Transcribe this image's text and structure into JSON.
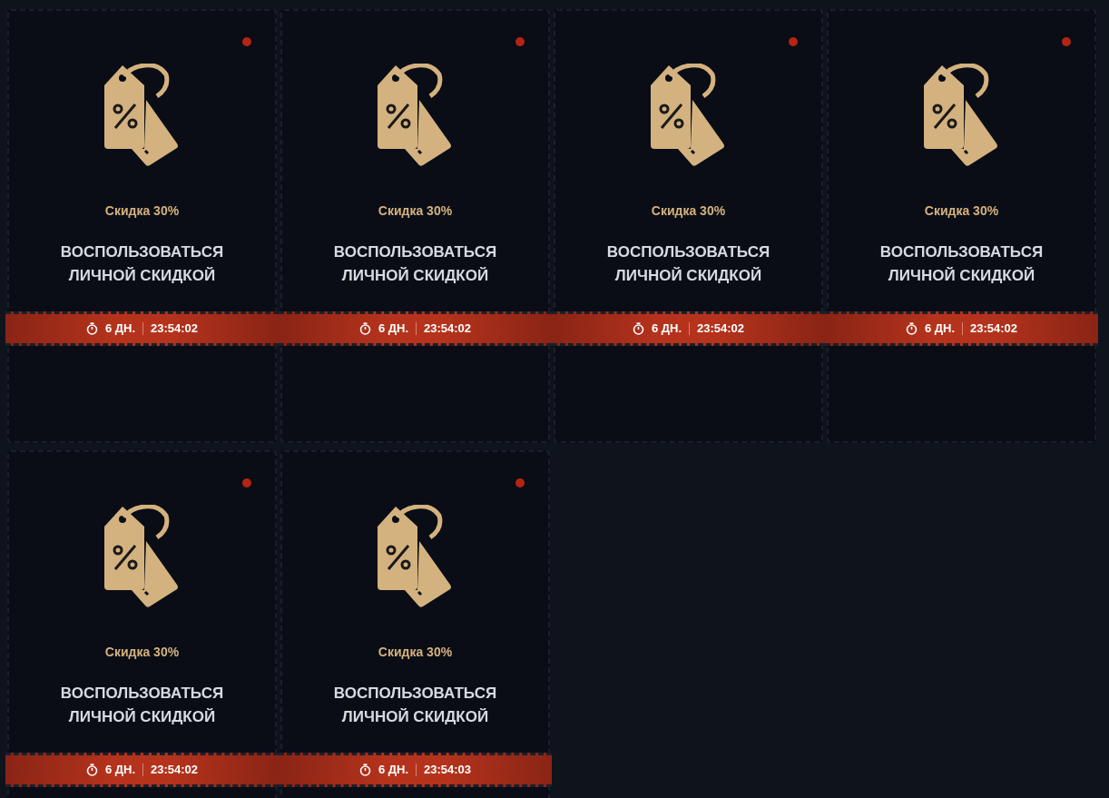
{
  "cards": [
    {
      "discount": "Скидка 30%",
      "title": "ВОСПОЛЬЗОВАТЬСЯ ЛИЧНОЙ СКИДКОЙ",
      "days": "6 ДН.",
      "time": "23:54:02",
      "unread": true
    },
    {
      "discount": "Скидка 30%",
      "title": "ВОСПОЛЬЗОВАТЬСЯ ЛИЧНОЙ СКИДКОЙ",
      "days": "6 ДН.",
      "time": "23:54:02",
      "unread": true
    },
    {
      "discount": "Скидка 30%",
      "title": "ВОСПОЛЬЗОВАТЬСЯ ЛИЧНОЙ СКИДКОЙ",
      "days": "6 ДН.",
      "time": "23:54:02",
      "unread": true
    },
    {
      "discount": "Скидка 30%",
      "title": "ВОСПОЛЬЗОВАТЬСЯ ЛИЧНОЙ СКИДКОЙ",
      "days": "6 ДН.",
      "time": "23:54:02",
      "unread": true
    },
    {
      "discount": "Скидка 30%",
      "title": "ВОСПОЛЬЗОВАТЬСЯ ЛИЧНОЙ СКИДКОЙ",
      "days": "6 ДН.",
      "time": "23:54:02",
      "unread": true
    },
    {
      "discount": "Скидка 30%",
      "title": "ВОСПОЛЬЗОВАТЬСЯ ЛИЧНОЙ СКИДКОЙ",
      "days": "6 ДН.",
      "time": "23:54:03",
      "unread": true
    }
  ]
}
